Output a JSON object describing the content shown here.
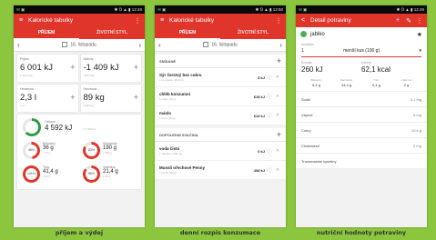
{
  "colors": {
    "background": "#8cc63f",
    "accent": "#e0352b",
    "ring_energy": "#2e9b47",
    "ring_macro": "#e0352b"
  },
  "phones": [
    {
      "status": {
        "left": "✉ ▣",
        "right": "✱ ⅁ ▲ ▮ 12:49"
      },
      "appbar": {
        "title": "Kalorické tabulky",
        "menu_icon": "menu-icon",
        "overflow": "⋮"
      },
      "tabs": [
        "PŘÍJEM",
        "ŽIVOTNÍ STYL"
      ],
      "date": "16. listopadu",
      "cards": [
        {
          "label": "Příjem",
          "value": "6 001 kJ",
          "sub": "1 434 kcal"
        },
        {
          "label": "Aktivity",
          "value": "-1 409 kJ",
          "sub": "-337 kcal"
        },
        {
          "label": "Hmotnost",
          "value": "2,3 l",
          "sub": "z 3 l"
        },
        {
          "label": "Hmotnost",
          "value": "89 kg",
          "sub": "cíl 84 kg"
        }
      ],
      "energy": {
        "label": "Celkem",
        "value": "4 592 kJ",
        "sub": "z 7 300 kJ",
        "pct": 63
      },
      "macros": [
        {
          "label": "Bílkoviny",
          "value": "36 g",
          "sub": "z 75 g",
          "pct": 48,
          "pct_text": "48%"
        },
        {
          "label": "Sacharidy",
          "value": "190 g",
          "sub": "z 230 g",
          "pct": 83,
          "pct_text": "83%"
        },
        {
          "label": "Tuky",
          "value": "41,4 g",
          "sub": "z 41 g",
          "pct": 100,
          "pct_text": "101%"
        },
        {
          "label": "Vláknina",
          "value": "21,4 g",
          "sub": "z 25 g",
          "pct": 86,
          "pct_text": "86%"
        }
      ],
      "caption": "příjem a výdej"
    },
    {
      "status": {
        "left": "✉ ▣",
        "right": "✱ ⅁ ▲ ▮ 12:50"
      },
      "appbar": {
        "title": "Kalorické tabulky",
        "overflow": "⋮"
      },
      "tabs": [
        "PŘÍJEM",
        "ŽIVOTNÍ STYL"
      ],
      "date": "16. listopadu",
      "sections": [
        {
          "title": "SNÍDANĚ",
          "items": [
            {
              "name": "Sýr čerstvý bez cukru",
              "sub": "1 ks (porce, 200 ml)",
              "kj": ""
            },
            {
              "name": "chléb konzumní",
              "sub": "1 krajíc (40 g)",
              "kj": "618 kJ"
            },
            {
              "name": "máslo",
              "sub": "1 lžíce (10 g)",
              "kj": "614 kJ"
            }
          ]
        },
        {
          "title": "DOPOLEDNÍ SVAČINA",
          "items": [
            {
              "name": "voda čistá",
              "sub": "1 sklenice (300 ml)",
              "kj": "0 kJ"
            },
            {
              "name": "Mussli ořechové Penny",
              "sub": "1 porce (50 g)",
              "kj": "408 kJ"
            }
          ]
        }
      ],
      "kj_first": "8 kJ",
      "caption": "denní rozpis konzumace"
    },
    {
      "status": {
        "left": "✉ ▣",
        "right": "✱ ⅁ ▲ ▮ 12:49"
      },
      "appbar": {
        "back": "<",
        "title": "Detail potraviny",
        "add": "+",
        "edit": "✎",
        "overflow": "⋮"
      },
      "food": "jablko",
      "qty_label": "Množství",
      "qty": "1",
      "unit": "menší kus (100 g)",
      "energy_label": "Energie",
      "energy": "260 kJ",
      "kcal_label": "Kalorie",
      "kcal": "62,1 kcal",
      "macros": [
        {
          "label": "Bílkoviny",
          "value": "0,4 g"
        },
        {
          "label": "Sacharidy",
          "value": "14,4 g"
        },
        {
          "label": "Tuky",
          "value": "0,4 g"
        },
        {
          "label": "Vláknina",
          "value": "2 g"
        }
      ],
      "nutrients": [
        {
          "label": "Sodík",
          "value": "0,1 mg"
        },
        {
          "label": "Vápník",
          "value": "5 mg"
        },
        {
          "label": "Cukry",
          "value": "10,4 g"
        },
        {
          "label": "Cholesterol",
          "value": "0 mg"
        },
        {
          "label": "Transmastné kyseliny",
          "value": ""
        }
      ],
      "caption": "nutriční hodnoty potraviny"
    }
  ]
}
